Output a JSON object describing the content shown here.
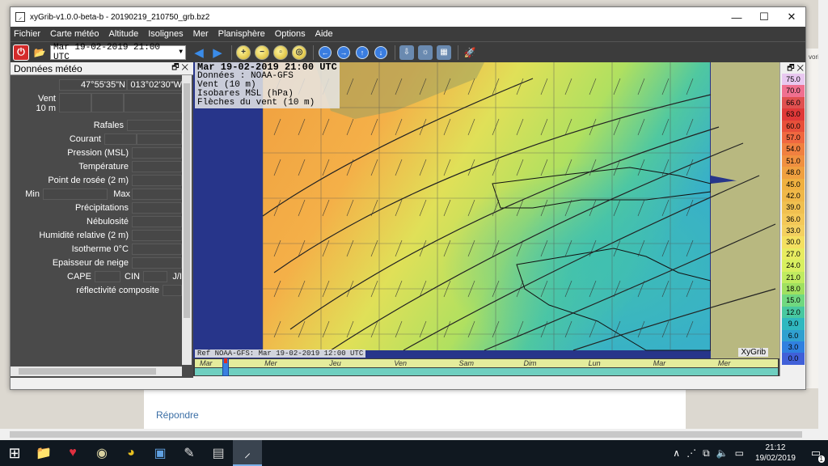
{
  "window": {
    "title": "xyGrib-v1.0.0-beta-b - 20190219_210750_grb.bz2",
    "controls": {
      "minimize": "—",
      "maximize": "☐",
      "close": "✕"
    }
  },
  "menu": [
    "Fichier",
    "Carte météo",
    "Altitude",
    "Isolignes",
    "Mer",
    "Planisphère",
    "Options",
    "Aide"
  ],
  "toolbar": {
    "date_select": "Mar 19-02-2019 21:00 UTC"
  },
  "left_panel": {
    "title": "Données météo",
    "header_icons": "🗗 ✕",
    "lat": "47°55'35\"N",
    "lon": "013°02'30\"W",
    "wind_label_1": "Vent",
    "wind_label_2": "10 m",
    "rows": [
      "Rafales",
      "Courant",
      "Pression (MSL)",
      "Température",
      "Point de rosée (2 m)",
      "Précipitations",
      "Nébulosité",
      "Humidité relative (2 m)",
      "Isotherme 0°C",
      "Epaisseur de neige"
    ],
    "min": "Min",
    "max": "Max",
    "cape": "CAPE",
    "cin": "CIN",
    "jkg": "J/I",
    "reflect": "réflectivité composite"
  },
  "map": {
    "info_date": "Mar 19-02-2019 21:00 UTC",
    "info_lines": [
      "Données : NOAA-GFS",
      "Vent (10 m)",
      "Isobares MSL (hPa)",
      "Flèches du vent (10 m)"
    ],
    "ref": "Ref NOAA-GFS: Mar 19-02-2019 12:00 UTC",
    "brand": "XyGrib"
  },
  "timeline": {
    "days": [
      "Mar",
      "Mer",
      "Jeu",
      "Ven",
      "Sam",
      "Dim",
      "Lun",
      "Mar",
      "Mer"
    ]
  },
  "legend": {
    "head": "🗗 ✕",
    "values": [
      "75.0",
      "70.0",
      "66.0",
      "63.0",
      "60.0",
      "57.0",
      "54.0",
      "51.0",
      "48.0",
      "45.0",
      "42.0",
      "39.0",
      "36.0",
      "33.0",
      "30.0",
      "27.0",
      "24.0",
      "21.0",
      "18.0",
      "15.0",
      "12.0",
      "9.0",
      "6.0",
      "3.0",
      "0.0"
    ],
    "colors": [
      "#e8c8f0",
      "#f07090",
      "#e05050",
      "#e03838",
      "#e8503a",
      "#f06840",
      "#f08040",
      "#f09040",
      "#f0a040",
      "#f0b040",
      "#f0b848",
      "#f0c050",
      "#f4c858",
      "#f4d060",
      "#f4e060",
      "#e8ec60",
      "#d8f060",
      "#c0ec60",
      "#a0e060",
      "#70d880",
      "#48c8a0",
      "#30b8c0",
      "#30a0d0",
      "#3080e0",
      "#4060d8"
    ]
  },
  "background": {
    "reply": "Répondre",
    "right_text": "voris"
  },
  "taskbar": {
    "time": "21:12",
    "date": "19/02/2019",
    "notif_count": "1"
  }
}
